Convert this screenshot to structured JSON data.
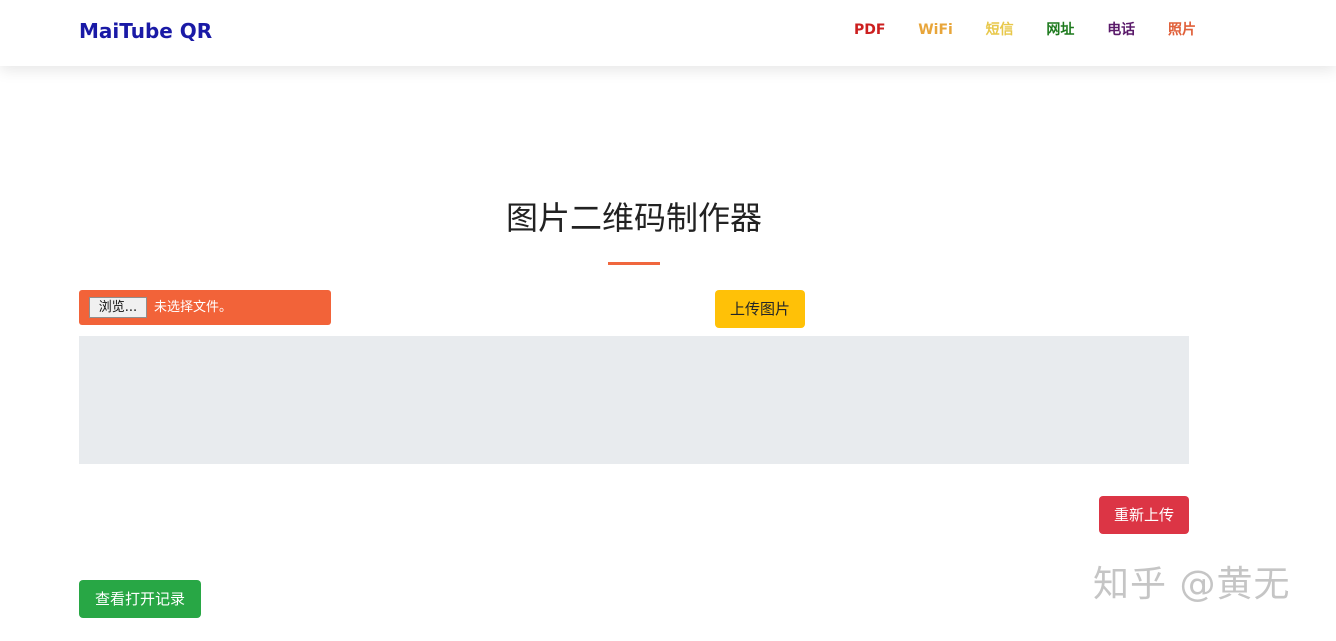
{
  "navbar": {
    "brand": "MaiTube QR",
    "brand_color": "#1a1aa6",
    "links": [
      {
        "label": "PDF",
        "color": "#cc1f1f"
      },
      {
        "label": "WiFi",
        "color": "#e8a53a"
      },
      {
        "label": "短信",
        "color": "#e8c84a"
      },
      {
        "label": "网址",
        "color": "#1e7a1e"
      },
      {
        "label": "电话",
        "color": "#5a1a6a"
      },
      {
        "label": "照片",
        "color": "#e0603a"
      }
    ]
  },
  "main": {
    "title": "图片二维码制作器",
    "accent_color": "#f0673e",
    "file_input": {
      "browse_label": "浏览...",
      "status": "未选择文件。"
    },
    "upload_button": "上传图片",
    "reupload_button": "重新上传",
    "history_button": "查看打开记录"
  },
  "watermark": "知乎 @黄无",
  "colors": {
    "upload": "#ffc107",
    "reupload": "#dc3545",
    "history": "#28a745",
    "file_input_bg": "#f26339",
    "preview_bg": "#e8ebee"
  }
}
